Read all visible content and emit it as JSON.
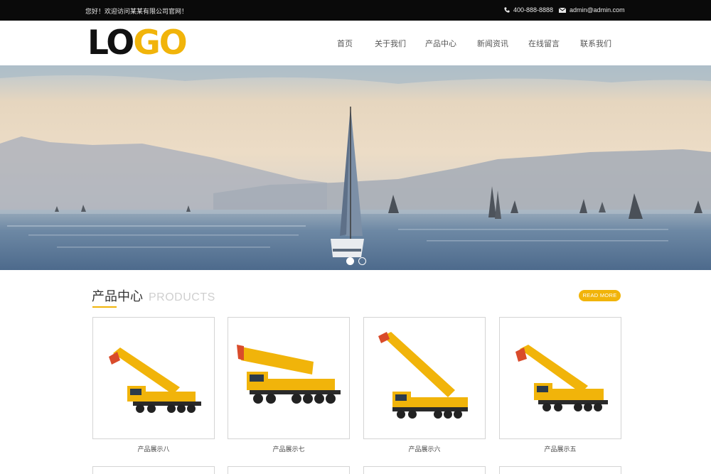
{
  "topbar": {
    "welcome": "您好！欢迎访问某某有限公司官网！",
    "phone": "400-888-8888",
    "email": "admin@admin.com"
  },
  "header": {
    "logo_part1": "LO",
    "logo_part2": "GO",
    "nav": [
      "首页",
      "关于我们",
      "产品中心",
      "新闻资讯",
      "在线留言",
      "联系我们"
    ]
  },
  "banner": {
    "slide_count": 2,
    "active_slide": 1
  },
  "products": {
    "title": "产品中心",
    "title_en": "PRODUCTS",
    "read_more": "READ MORE",
    "items": [
      {
        "name": "产品展示八"
      },
      {
        "name": "产品展示七"
      },
      {
        "name": "产品展示六"
      },
      {
        "name": "产品展示五"
      }
    ]
  },
  "colors": {
    "accent": "#f1b40a",
    "topbar": "#0a0a0a"
  }
}
